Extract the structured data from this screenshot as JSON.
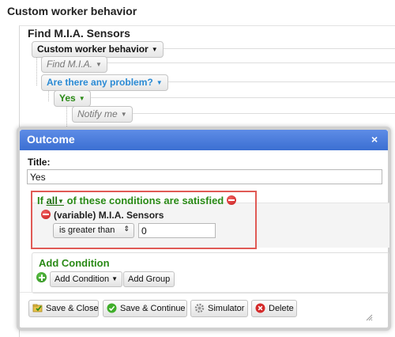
{
  "page": {
    "title": "Custom worker behavior"
  },
  "tree": {
    "panel_title": "Find M.I.A. Sensors",
    "root_pill": "Custom worker behavior",
    "action_pill": "Find M.I.A.",
    "question_pill": "Are there any problem?",
    "answer_pill": "Yes",
    "notify_pill": "Notify me"
  },
  "dialog": {
    "title": "Outcome",
    "close_symbol": "×",
    "title_label": "Title:",
    "title_value": "Yes",
    "conditions": {
      "prefix": "If",
      "quantifier": "all",
      "suffix": "of these conditions are satisfied",
      "items": [
        {
          "variable": "(variable) M.I.A. Sensors",
          "operator": "is greater than",
          "value": "0"
        }
      ]
    },
    "add_condition": {
      "heading": "Add Condition",
      "add_condition_button": "Add Condition",
      "add_group_button": "Add Group"
    },
    "footer": {
      "save_close": "Save & Close",
      "save_continue": "Save & Continue",
      "simulator": "Simulator",
      "delete": "Delete"
    }
  },
  "colors": {
    "header_blue": "#3b6fd2",
    "condition_green": "#2a8a16",
    "highlight_red": "#e05a55",
    "link_blue": "#2a8ad4"
  }
}
